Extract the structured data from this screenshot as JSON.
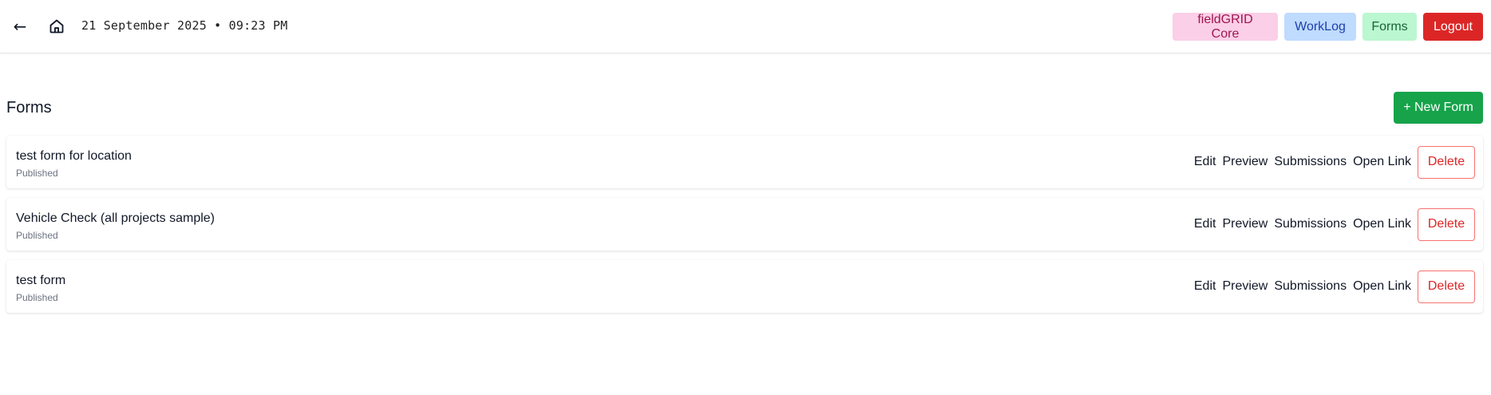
{
  "header": {
    "back_icon": "←",
    "home_icon": "home-icon",
    "datetime": "21 September 2025 • 09:23 PM",
    "nav": {
      "core_label": "fieldGRID Core",
      "worklog_label": "WorkLog",
      "forms_label": "Forms",
      "logout_label": "Logout"
    }
  },
  "main": {
    "title": "Forms",
    "new_form_label": "+ New Form",
    "forms": [
      {
        "name": "test form for location",
        "status": "Published"
      },
      {
        "name": "Vehicle Check (all projects sample)",
        "status": "Published"
      },
      {
        "name": "test form",
        "status": "Published"
      }
    ],
    "actions": {
      "edit": "Edit",
      "preview": "Preview",
      "submissions": "Submissions",
      "open_link": "Open Link",
      "delete": "Delete"
    }
  },
  "colors": {
    "core_bg": "#fbcfe8",
    "worklog_bg": "#bfdbfe",
    "forms_bg": "#bbf7d0",
    "logout_bg": "#dc2626",
    "new_form_bg": "#16a34a",
    "delete_text": "#dc2626"
  }
}
